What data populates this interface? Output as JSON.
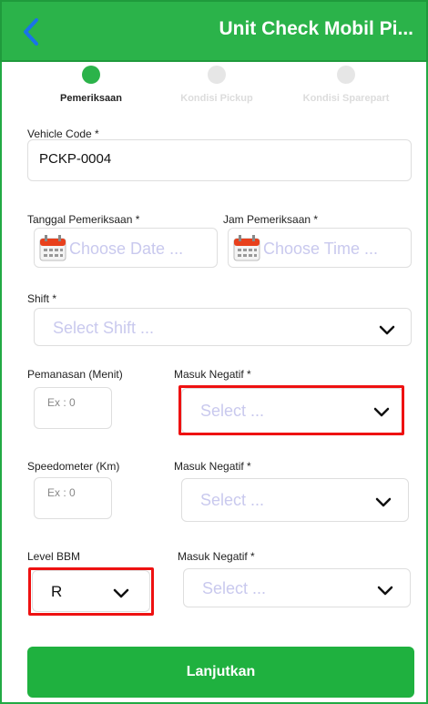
{
  "header": {
    "title": "Unit Check Mobil Pi...",
    "back_icon": "chevron-left-icon"
  },
  "steps": [
    {
      "label": "Pemeriksaan",
      "active": true
    },
    {
      "label": "Kondisi Pickup",
      "active": false
    },
    {
      "label": "Kondisi Sparepart",
      "active": false
    }
  ],
  "form": {
    "vehicle_code": {
      "label": "Vehicle Code *",
      "value": "PCKP-0004"
    },
    "tanggal": {
      "label": "Tanggal Pemeriksaan *",
      "placeholder": "Choose Date ..."
    },
    "jam": {
      "label": "Jam Pemeriksaan *",
      "placeholder": "Choose Time ..."
    },
    "shift": {
      "label": "Shift *",
      "placeholder": "Select Shift ..."
    },
    "pemanasan": {
      "label": "Pemanasan (Menit)",
      "placeholder": "Ex : 0"
    },
    "masuk_negatif_1": {
      "label": "Masuk Negatif *",
      "placeholder": "Select ..."
    },
    "speedometer": {
      "label": "Speedometer (Km)",
      "placeholder": "Ex : 0"
    },
    "masuk_negatif_2": {
      "label": "Masuk Negatif *",
      "placeholder": "Select ..."
    },
    "level_bbm": {
      "label": "Level BBM",
      "value": "R"
    },
    "masuk_negatif_3": {
      "label": "Masuk Negatif *",
      "placeholder": "Select ..."
    }
  },
  "submit": {
    "label": "Lanjutkan"
  },
  "colors": {
    "brand": "#2bb34a",
    "highlight": "#ee1111"
  }
}
